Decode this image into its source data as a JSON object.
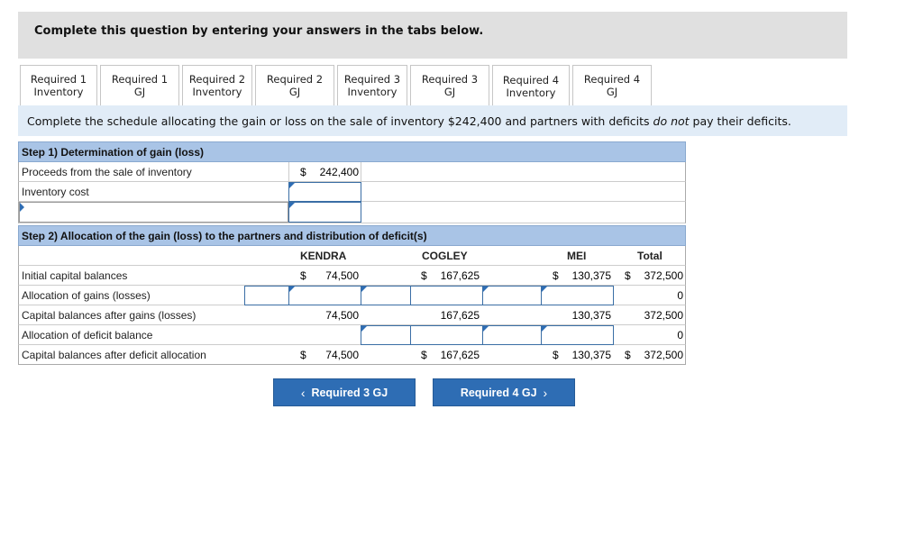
{
  "banner": {
    "text": "Complete this question by entering your answers in the tabs below."
  },
  "tabs": [
    {
      "line1": "Required 1",
      "line2": "Inventory",
      "active": false
    },
    {
      "line1": "Required 1 GJ",
      "line2": "",
      "active": false
    },
    {
      "line1": "Required 2",
      "line2": "Inventory",
      "active": false
    },
    {
      "line1": "Required 2 GJ",
      "line2": "",
      "active": false
    },
    {
      "line1": "Required 3",
      "line2": "Inventory",
      "active": false
    },
    {
      "line1": "Required 3 GJ",
      "line2": "",
      "active": false
    },
    {
      "line1": "Required 4",
      "line2": "Inventory",
      "active": true
    },
    {
      "line1": "Required 4 GJ",
      "line2": "",
      "active": false
    }
  ],
  "instructions": {
    "pre": "Complete the schedule allocating the gain or loss on the sale of inventory $242,400 and partners with deficits ",
    "emph": "do not",
    "post": " pay their deficits."
  },
  "step1": {
    "header": "Step 1) Determination of gain (loss)",
    "rows": [
      {
        "label": "Proceeds from the sale of inventory",
        "dollar": "$",
        "value": "242,400"
      },
      {
        "label": "Inventory cost",
        "value": ""
      },
      {
        "label": "",
        "value": ""
      }
    ]
  },
  "step2": {
    "header": "Step 2) Allocation of the gain (loss) to the partners and distribution of deficit(s)",
    "columns": [
      "KENDRA",
      "COGLEY",
      "MEI",
      "Total"
    ],
    "rows": [
      {
        "label": "Initial capital balances",
        "kendra": "74,500",
        "cogley": "167,625",
        "mei": "130,375",
        "total": "372,500",
        "dollar": "$"
      },
      {
        "label": "Allocation of gains (losses)",
        "kendra": "",
        "cogley": "",
        "mei": "",
        "total": "0"
      },
      {
        "label": "Capital balances after gains (losses)",
        "kendra": "74,500",
        "cogley": "167,625",
        "mei": "130,375",
        "total": "372,500"
      },
      {
        "label": "Allocation of deficit balance",
        "kendra": "",
        "cogley": "",
        "mei": "",
        "total": "0"
      },
      {
        "label": "Capital balances after deficit allocation",
        "kendra": "74,500",
        "cogley": "167,625",
        "mei": "130,375",
        "total": "372,500",
        "dollar": "$"
      }
    ]
  },
  "nav": {
    "prev_label": "Required 3 GJ",
    "next_label": "Required 4 GJ",
    "prev_icon": "‹",
    "next_icon": "›"
  }
}
